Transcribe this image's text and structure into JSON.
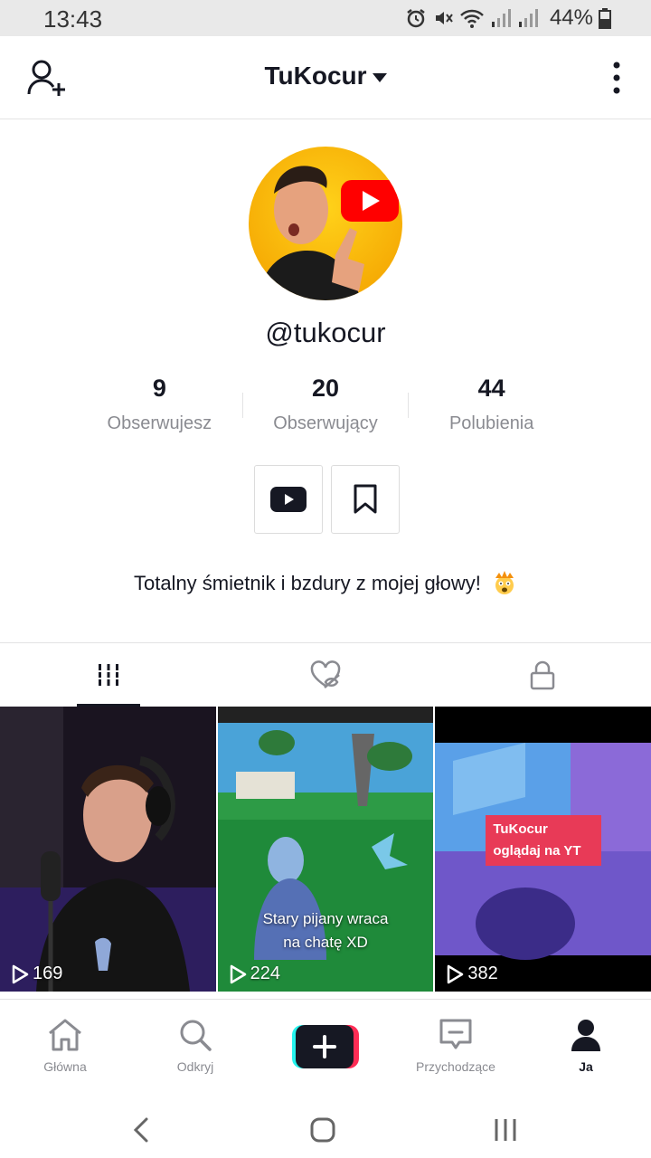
{
  "status_bar": {
    "time": "13:43",
    "battery": "44%"
  },
  "header": {
    "title": "TuKocur"
  },
  "profile": {
    "username": "@tukocur",
    "stats": [
      {
        "value": "9",
        "label": "Obserwujesz"
      },
      {
        "value": "20",
        "label": "Obserwujący"
      },
      {
        "value": "44",
        "label": "Polubienia"
      }
    ],
    "bio": "Totalny śmietnik i bzdury z mojej głowy!"
  },
  "videos": [
    {
      "views": "169",
      "caption": ""
    },
    {
      "views": "224",
      "caption": "Stary pijany wraca\nna chatę XD"
    },
    {
      "views": "382",
      "caption": "",
      "banner": "TuKocur oglądaj na YT"
    }
  ],
  "bottom_nav": [
    {
      "label": "Główna",
      "icon": "home-icon"
    },
    {
      "label": "Odkryj",
      "icon": "search-icon"
    },
    {
      "label": "",
      "icon": "plus-icon"
    },
    {
      "label": "Przychodzące",
      "icon": "inbox-icon"
    },
    {
      "label": "Ja",
      "icon": "profile-icon"
    }
  ],
  "colors": {
    "accent_pink": "#fe2c55",
    "accent_cyan": "#25f4ee",
    "text": "#161823",
    "muted": "#8a8b91"
  }
}
